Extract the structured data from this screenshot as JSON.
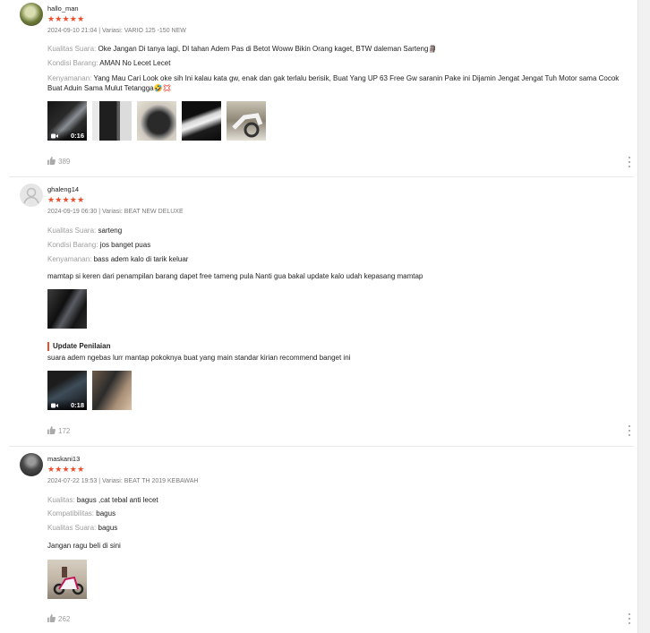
{
  "reviews": [
    {
      "username": "hallo_man",
      "stars": "★★★★★",
      "meta": "2024-09-10 21:04 | Variasi: VARIO 125 -150 NEW",
      "attributes": [
        {
          "key": "Kualitas Suara:",
          "value": "Oke Jangan Di tanya lagi, DI tahan Adem Pas di Betot Woww Bikin Orang kaget, BTW daleman Sarteng🗿"
        },
        {
          "key": "Kondisi Barang:",
          "value": "AMAN No Lecet Lecet"
        },
        {
          "key": "Kenyamanan:",
          "value": "Yang Mau Cari Look oke sih Ini kalau kata gw, enak dan gak terlalu berisik, Buat Yang UP 63 Free Gw saranin Pake ini Dijamin Jengat Jengat Tuh Motor sama Cocok Buat Aduin Sama Mulut Tetangga🤣💢"
        }
      ],
      "media": [
        {
          "type": "video",
          "duration": "0:16"
        },
        {
          "type": "image"
        },
        {
          "type": "image"
        },
        {
          "type": "image"
        },
        {
          "type": "image"
        }
      ],
      "likes": "389"
    },
    {
      "username": "ghaleng14",
      "stars": "★★★★★",
      "meta": "2024-09-19 06:30 | Variasi: BEAT NEW DELUXE",
      "attributes": [
        {
          "key": "Kualitas Suara:",
          "value": "sarteng"
        },
        {
          "key": "Kondisi Barang:",
          "value": "jos banget puas"
        },
        {
          "key": "Kenyamanan:",
          "value": "bass adem kalo di tarik keluar"
        }
      ],
      "comment": "mamtap si keren dari penampilan barang dapet free tameng pula Nanti gua bakal update kalo udah kepasang mamtap",
      "media": [
        {
          "type": "image"
        }
      ],
      "update_label": "Update Penilaian",
      "update_text": "suara adem ngebas lurr mantap pokoknya buat yang main standar kirian recommend banget ini",
      "update_media": [
        {
          "type": "video",
          "duration": "0:18"
        },
        {
          "type": "image"
        }
      ],
      "likes": "172"
    },
    {
      "username": "maskani13",
      "stars": "★★★★★",
      "meta": "2024-07-22 19:53 | Variasi: BEAT TH 2019 KEBAWAH",
      "attributes": [
        {
          "key": "Kualitas:",
          "value": "bagus ,cat tebal anti lecet"
        },
        {
          "key": "Kompatibilitas:",
          "value": "bagus"
        },
        {
          "key": "Kualitas Suara:",
          "value": "bagus"
        }
      ],
      "comment": "Jangan ragu beli di sini",
      "media": [
        {
          "type": "image"
        }
      ],
      "likes": "262"
    }
  ],
  "icons": {
    "like": "thumbs-up-icon",
    "more": "more-vertical-icon",
    "video": "video-camera-icon"
  },
  "colors": {
    "star": "#ee4d2d",
    "muted": "rgba(0,0,0,.4)"
  }
}
